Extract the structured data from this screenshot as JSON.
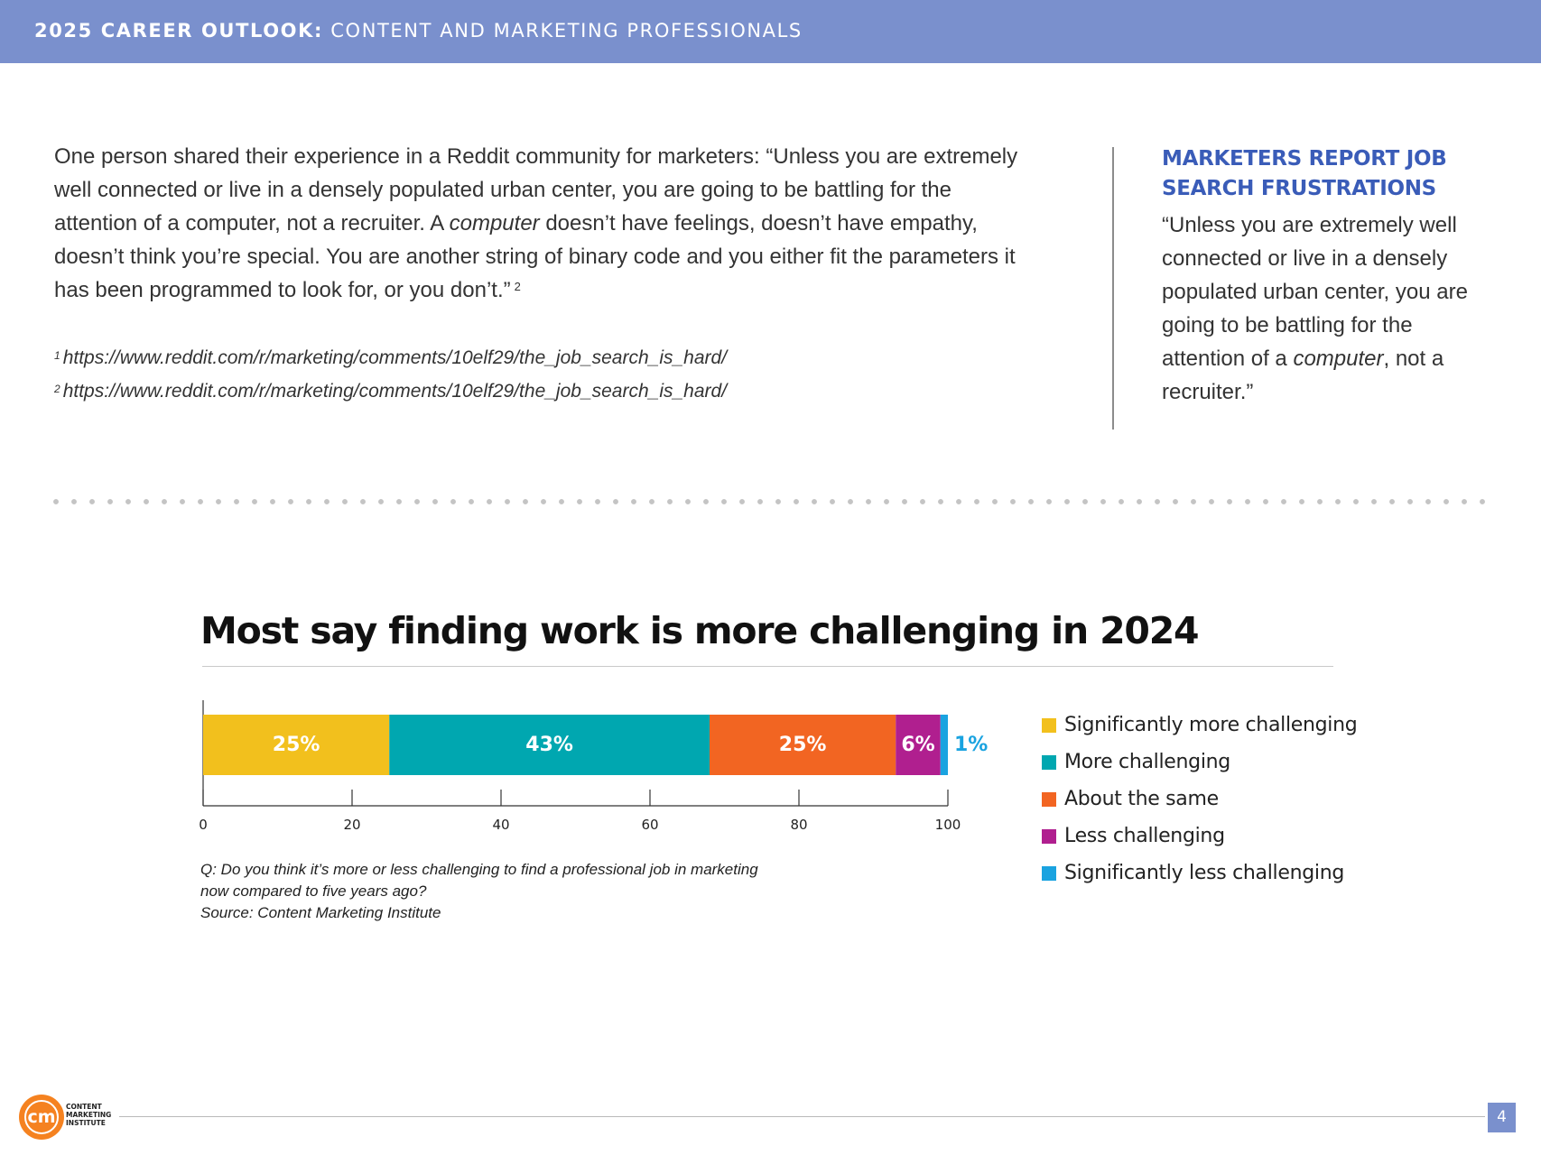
{
  "header": {
    "title_bold": "2025 CAREER OUTLOOK:",
    "title_rest": "CONTENT AND MARKETING PROFESSIONALS"
  },
  "main": {
    "body_part1": "One person shared their experience in a Reddit community for marketers: “Unless you are extremely well connected or live in a densely populated urban center, you are going to be battling for the attention of a computer, not a recruiter. A ",
    "body_italic": "computer",
    "body_part2": " doesn’t have feelings, doesn’t have empathy, doesn’t think you’re special. You are another string of binary code and you either fit the parameters it has been programmed to look for, or you don’t.”",
    "body_footnote_ref": "2",
    "footnotes": [
      {
        "num": "1",
        "url": "https://www.reddit.com/r/marketing/comments/10elf29/the_job_search_is_hard/"
      },
      {
        "num": "2",
        "url": "https://www.reddit.com/r/marketing/comments/10elf29/the_job_search_is_hard/"
      }
    ]
  },
  "sidebar": {
    "title": "MARKETERS REPORT JOB SEARCH FRUSTRATIONS",
    "quote_part1": "“Unless you are extremely well connected or live in a densely populated urban center, you are going to be battling for the attention of a ",
    "quote_italic": "computer",
    "quote_part2": ", not a recruiter.”"
  },
  "chart_data": {
    "type": "bar",
    "orientation": "horizontal-stacked",
    "title": "Most say finding work is more challenging in 2024",
    "xlim": [
      0,
      100
    ],
    "x_ticks": [
      "0",
      "20",
      "40",
      "60",
      "80",
      "100"
    ],
    "legend_position": "right",
    "series": [
      {
        "name": "Significantly more challenging",
        "value": 25,
        "label": "25%",
        "color": "#f2c01d"
      },
      {
        "name": "More challenging",
        "value": 43,
        "label": "43%",
        "color": "#00a7b0"
      },
      {
        "name": "About the same",
        "value": 25,
        "label": "25%",
        "color": "#f26522"
      },
      {
        "name": "Less challenging",
        "value": 6,
        "label": "6%",
        "color": "#b01f8f"
      },
      {
        "name": "Significantly less challenging",
        "value": 1,
        "label": "1%",
        "color": "#1aa3e0"
      }
    ],
    "caption_lines": [
      "Q: Do you think it’s more or less challenging to find a professional job in marketing",
      "now compared to five years ago?",
      "Source: Content Marketing Institute"
    ]
  },
  "footer": {
    "logo_mark": "cm",
    "logo_lines": [
      "CONTENT",
      "MARKETING",
      "INSTITUTE"
    ],
    "page_number": "4"
  },
  "colors": {
    "header_band": "#7a90cd",
    "sidebar_title": "#3a5cb8",
    "logo": "#f58220"
  }
}
